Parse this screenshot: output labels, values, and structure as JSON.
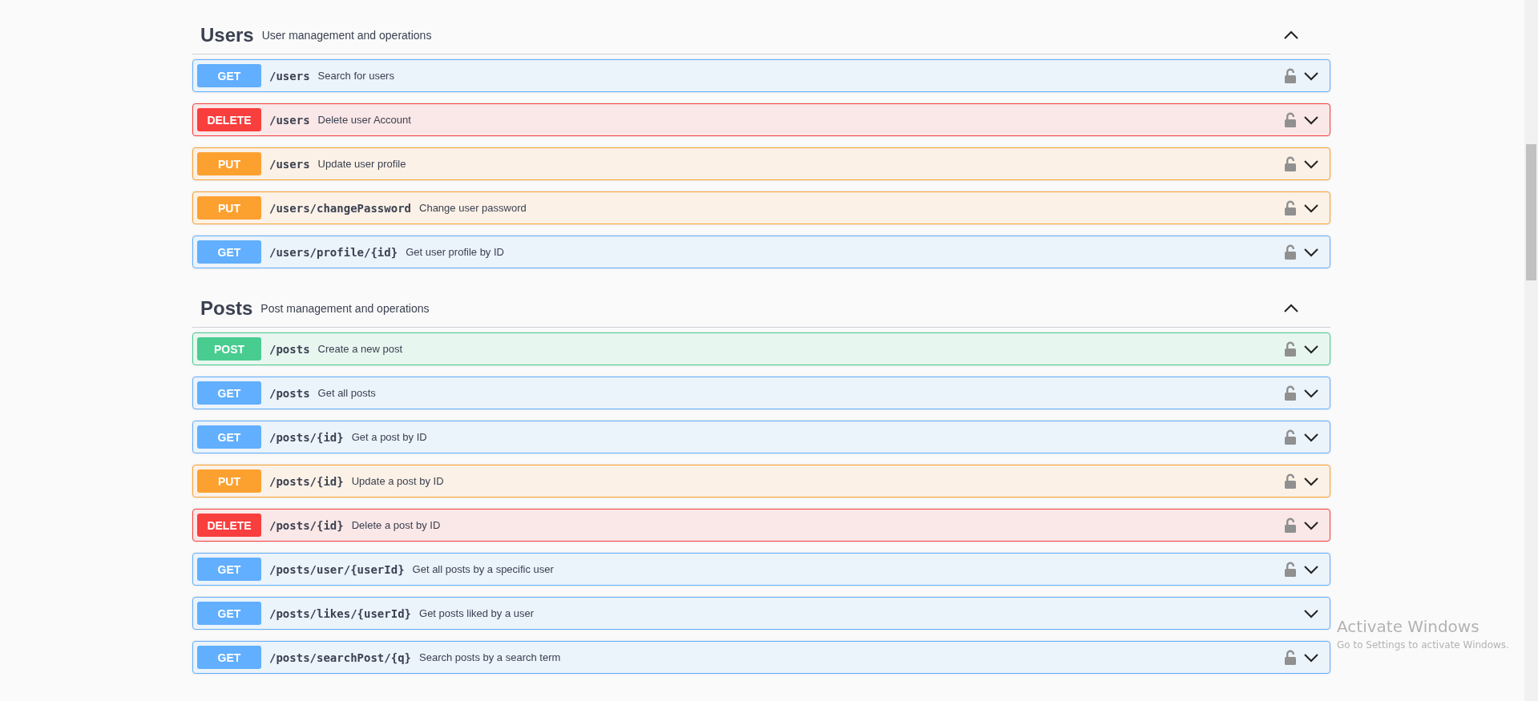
{
  "sections": [
    {
      "name": "Users",
      "description": "User management and operations",
      "expanded": true,
      "operations": [
        {
          "method": "GET",
          "path": "/users",
          "summary": "Search for users",
          "auth": true
        },
        {
          "method": "DELETE",
          "path": "/users",
          "summary": "Delete user Account",
          "auth": true
        },
        {
          "method": "PUT",
          "path": "/users",
          "summary": "Update user profile",
          "auth": true
        },
        {
          "method": "PUT",
          "path": "/users/changePassword",
          "summary": "Change user password",
          "auth": true
        },
        {
          "method": "GET",
          "path": "/users/profile/{id}",
          "summary": "Get user profile by ID",
          "auth": true
        }
      ]
    },
    {
      "name": "Posts",
      "description": "Post management and operations",
      "expanded": true,
      "operations": [
        {
          "method": "POST",
          "path": "/posts",
          "summary": "Create a new post",
          "auth": true
        },
        {
          "method": "GET",
          "path": "/posts",
          "summary": "Get all posts",
          "auth": true
        },
        {
          "method": "GET",
          "path": "/posts/{id}",
          "summary": "Get a post by ID",
          "auth": true
        },
        {
          "method": "PUT",
          "path": "/posts/{id}",
          "summary": "Update a post by ID",
          "auth": true
        },
        {
          "method": "DELETE",
          "path": "/posts/{id}",
          "summary": "Delete a post by ID",
          "auth": true
        },
        {
          "method": "GET",
          "path": "/posts/user/{userId}",
          "summary": "Get all posts by a specific user",
          "auth": true
        },
        {
          "method": "GET",
          "path": "/posts/likes/{userId}",
          "summary": "Get posts liked by a user",
          "auth": false
        },
        {
          "method": "GET",
          "path": "/posts/searchPost/{q}",
          "summary": "Search posts by a search term",
          "auth": true
        }
      ]
    }
  ],
  "os_overlay": {
    "title": "Activate Windows",
    "subtitle": "Go to Settings to activate Windows."
  }
}
